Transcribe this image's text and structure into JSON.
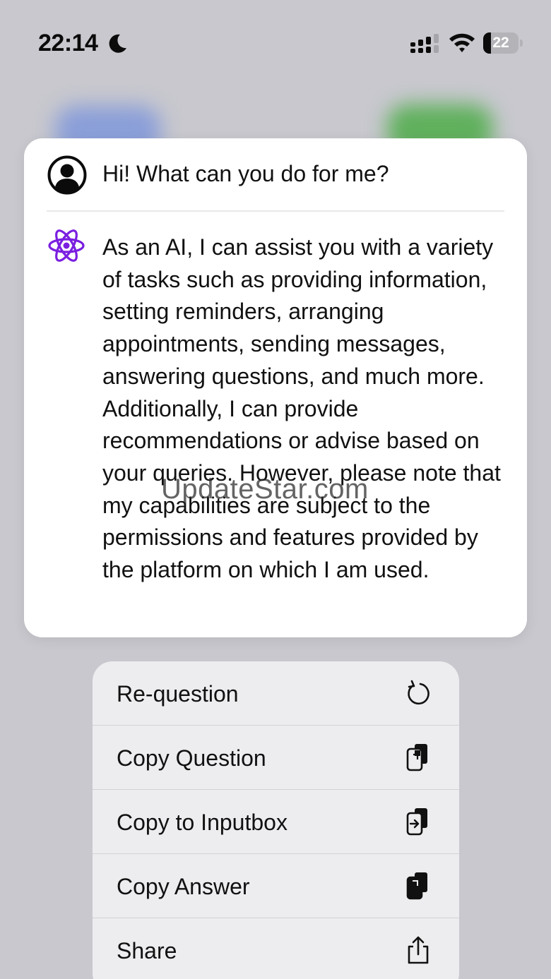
{
  "status_bar": {
    "time": "22:14",
    "battery_level": "22",
    "battery_fraction": 0.22,
    "icons": [
      "moon-icon",
      "signal-icon",
      "wifi-icon",
      "battery-icon"
    ]
  },
  "chat": {
    "question": "Hi! What can you do for me?",
    "answer": "As an AI, I can assist you with a variety of tasks such as providing information, setting reminders, arranging appointments, sending messages, answering questions, and much more. Additionally, I can provide recommendations or advise based on your queries. However, please note that my capabilities are subject to the permissions and features provided by the platform on which I am used.",
    "user_icon": "user-avatar-icon",
    "ai_icon": "atom-icon",
    "ai_icon_color": "#7a1fe0"
  },
  "watermark": "UpdateStar.com",
  "menu": {
    "items": [
      {
        "label": "Re-question",
        "icon": "refresh-icon"
      },
      {
        "label": "Copy Question",
        "icon": "copy-question-icon"
      },
      {
        "label": "Copy to Inputbox",
        "icon": "copy-to-inputbox-icon"
      },
      {
        "label": "Copy Answer",
        "icon": "copy-answer-icon"
      },
      {
        "label": "Share",
        "icon": "share-icon"
      }
    ]
  }
}
